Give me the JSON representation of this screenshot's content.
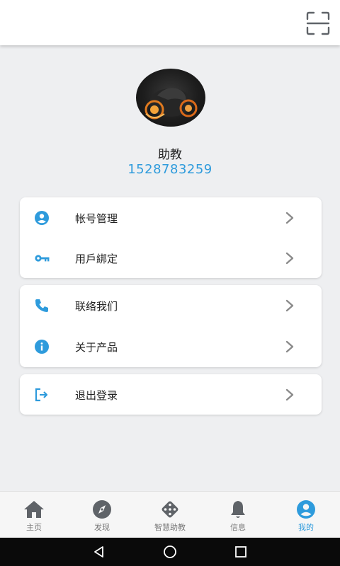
{
  "header": {
    "scan_icon": "scan-icon"
  },
  "profile": {
    "avatar": "avatar-image",
    "name": "助教",
    "id": "1528783259"
  },
  "menu_groups": [
    {
      "items": [
        {
          "label": "帐号管理",
          "icon": "user-circle-icon"
        },
        {
          "label": "用戶綁定",
          "icon": "key-icon"
        }
      ]
    },
    {
      "items": [
        {
          "label": "联络我们",
          "icon": "phone-icon"
        },
        {
          "label": "关于产品",
          "icon": "info-icon"
        }
      ]
    },
    {
      "items": [
        {
          "label": "退出登录",
          "icon": "logout-icon"
        }
      ]
    }
  ],
  "bottom_nav": [
    {
      "label": "主页",
      "icon": "home-icon"
    },
    {
      "label": "发现",
      "icon": "compass-icon"
    },
    {
      "label": "智慧助教",
      "icon": "dice-icon"
    },
    {
      "label": "信息",
      "icon": "bell-icon"
    },
    {
      "label": "我的",
      "icon": "user-circle-icon",
      "active": true
    }
  ],
  "colors": {
    "accent": "#2e9bdc",
    "icon_gray": "#5f6368",
    "chevron": "#8a8a8a"
  }
}
